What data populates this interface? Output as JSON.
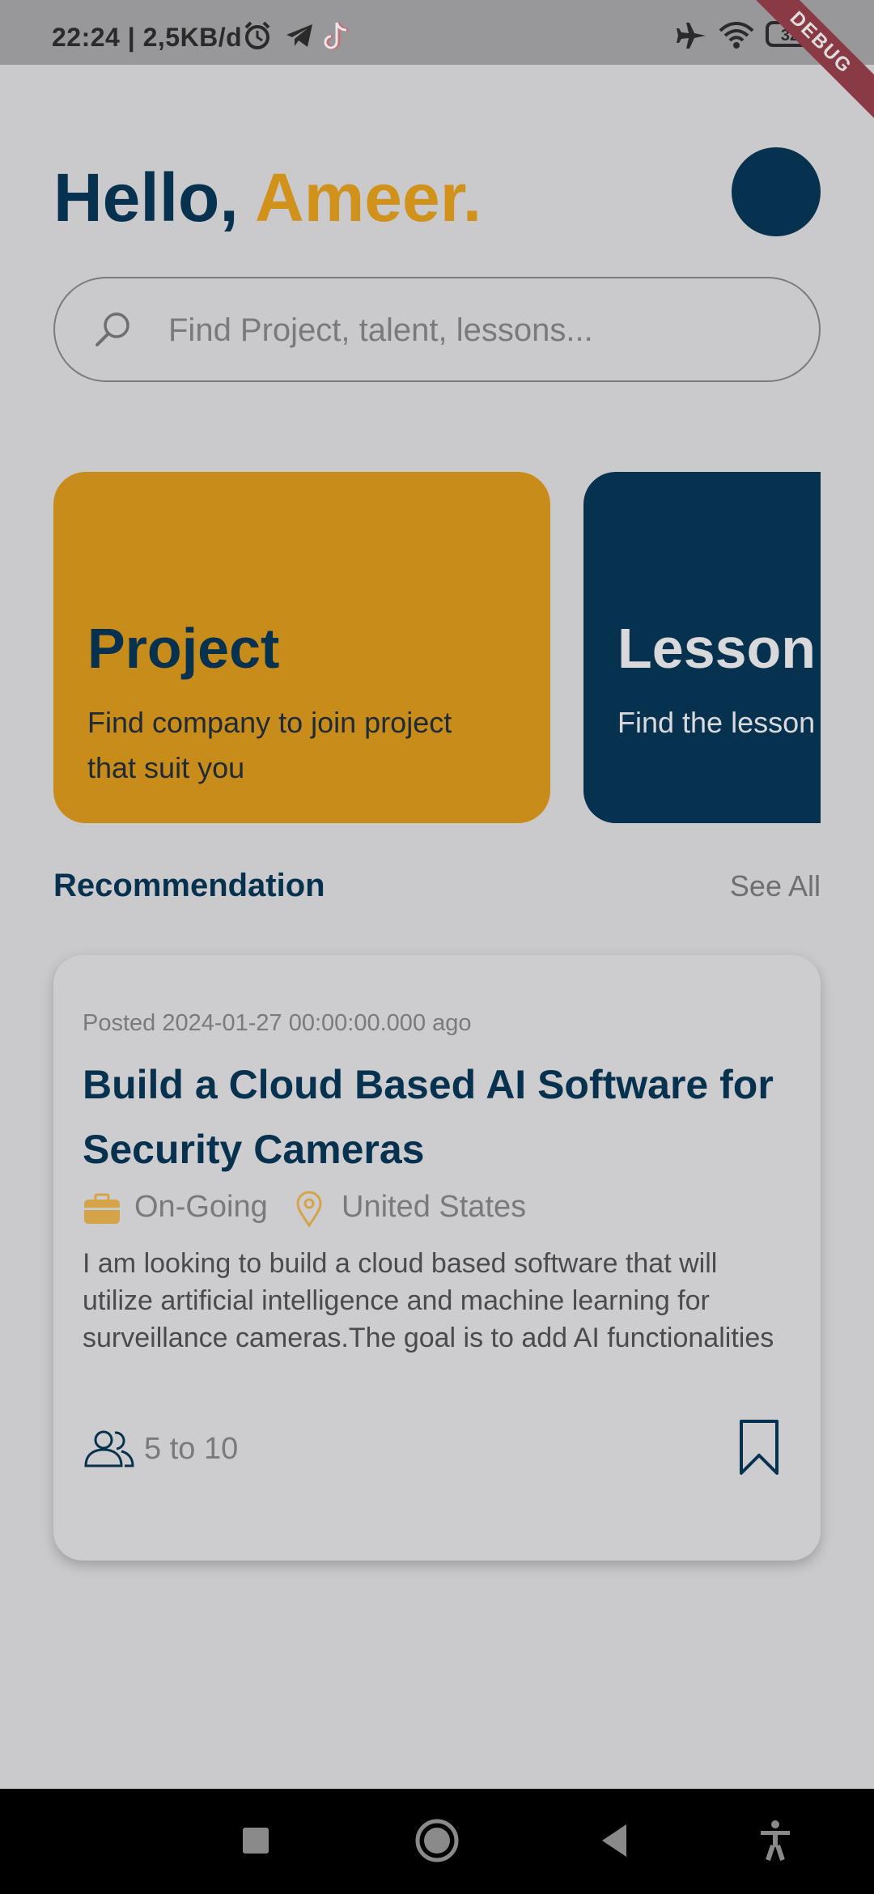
{
  "status_bar": {
    "time_speed": "22:24 | 2,5KB/d",
    "icons": [
      "alarm-icon",
      "telegram-icon",
      "tiktok-icon",
      "airplane-icon",
      "wifi-icon",
      "battery-icon"
    ],
    "battery": "32",
    "debug_label": "DEBUG"
  },
  "header": {
    "greeting": "Hello,",
    "name": "Ameer."
  },
  "search": {
    "placeholder": "Find Project, talent, lessons..."
  },
  "categories": [
    {
      "title": "Project",
      "description": "Find company to join project that suit you",
      "color": "#c88c1a"
    },
    {
      "title": "Lesson",
      "description": "Find the lesson project you hav",
      "color": "#07324f"
    }
  ],
  "recommendation": {
    "heading": "Recommendation",
    "see_all": "See All"
  },
  "job": {
    "posted": "Posted 2024-01-27 00:00:00.000 ago",
    "title": "Build a Cloud Based AI Software for Security Cameras",
    "status": "On-Going",
    "location": "United States",
    "description": "I am looking to build a cloud based software that will utilize artificial intelligence and machine learning for surveillance cameras.The goal is to add AI functionalities",
    "team_size": "5 to 10"
  },
  "colors": {
    "primary": "#07324f",
    "accent": "#d1921b"
  }
}
